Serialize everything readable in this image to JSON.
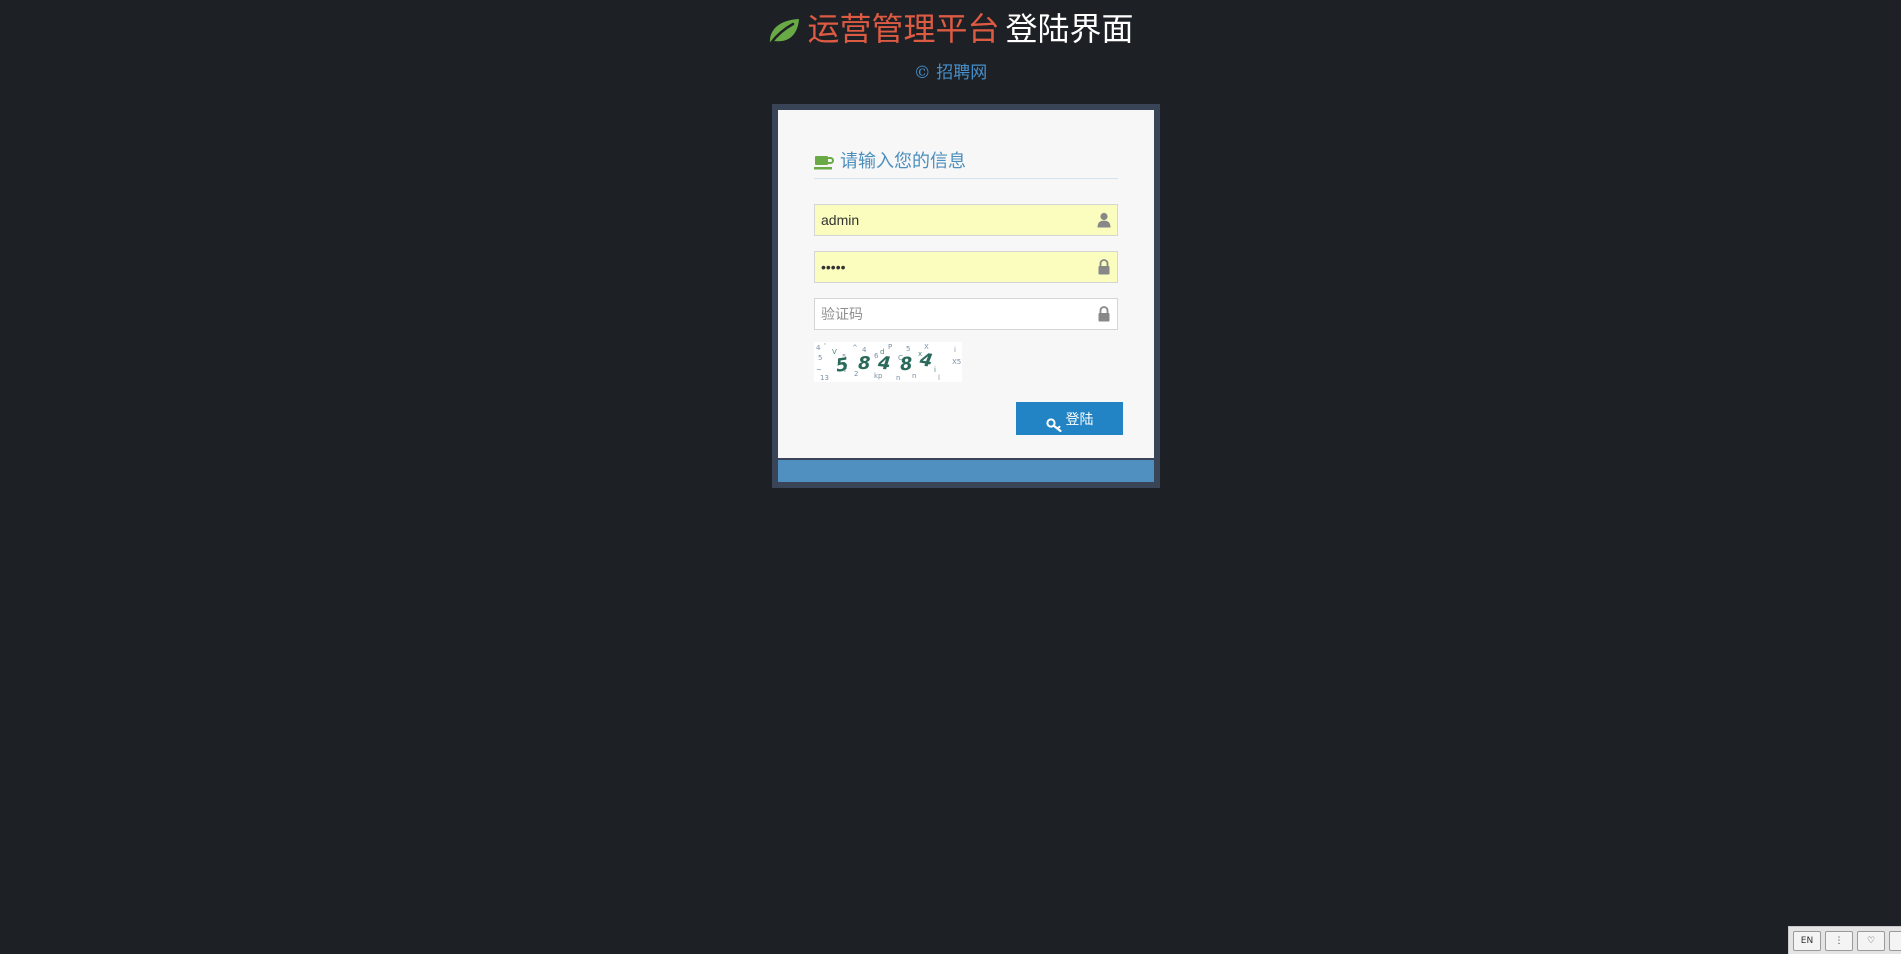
{
  "header": {
    "title_highlight": "运营管理平台",
    "title_rest": "登陆界面",
    "copyright": "© 招聘网",
    "logo_icon": "leaf-icon",
    "colors": {
      "highlight": "#dd5a43",
      "leaf": "#69aa46",
      "copyright": "#478fca",
      "background": "#1d2024"
    }
  },
  "login": {
    "heading": "请输入您的信息",
    "heading_icon": "coffee-icon",
    "username": {
      "value": "admin",
      "icon": "user-icon"
    },
    "password": {
      "value": "•••••",
      "icon": "lock-icon"
    },
    "captcha_input": {
      "value": "",
      "placeholder": "验证码",
      "icon": "lock-icon"
    },
    "captcha_image": {
      "code": "58484"
    },
    "submit": {
      "label": "登陆",
      "icon": "key-icon",
      "color": "#2283c5"
    },
    "footer_color": "#5090c1"
  },
  "tray": {
    "lang_label": "EN",
    "more_label": "⋮",
    "fav_label": "♡"
  }
}
